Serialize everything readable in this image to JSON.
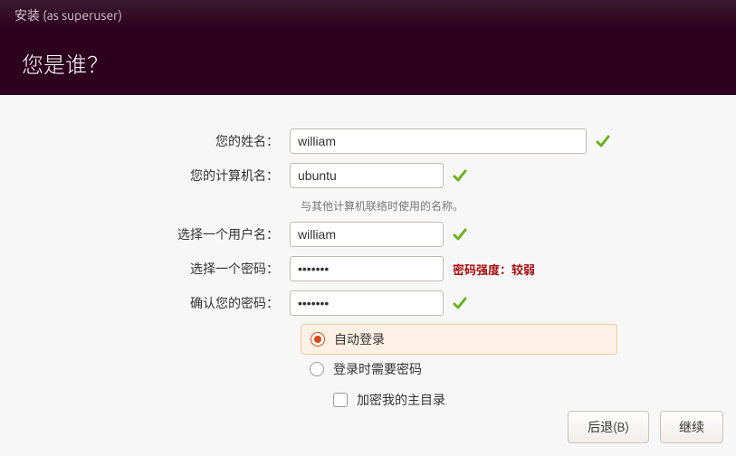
{
  "titlebar": "安装 (as superuser)",
  "heading": "您是谁？",
  "labels": {
    "name": "您的姓名：",
    "computer": "您的计算机名：",
    "computer_hint": "与其他计算机联络时使用的名称。",
    "username": "选择一个用户名：",
    "password": "选择一个密码：",
    "confirm": "确认您的密码："
  },
  "values": {
    "name": "william",
    "computer": "ubuntu",
    "username": "william",
    "password": "•••••••",
    "confirm": "•••••••"
  },
  "password_strength": "密码强度：较弱",
  "options": {
    "auto_login": "自动登录",
    "require_password": "登录时需要密码",
    "encrypt_home": "加密我的主目录"
  },
  "buttons": {
    "back": "后退(B)",
    "continue": "继续"
  }
}
